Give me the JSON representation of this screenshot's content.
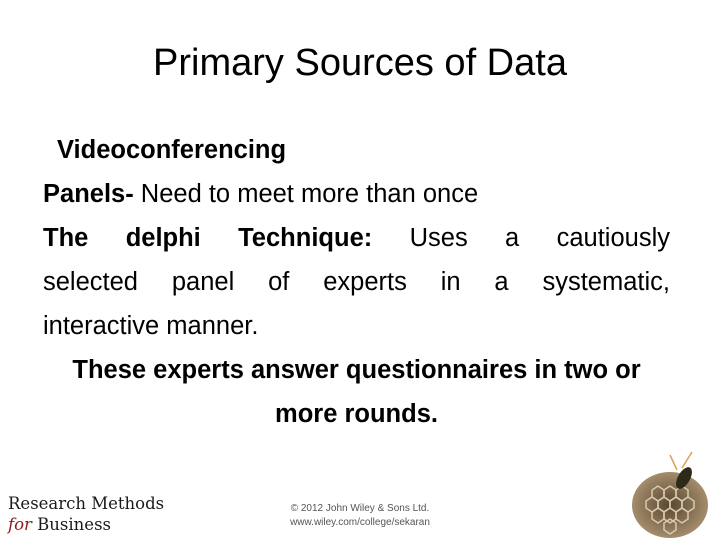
{
  "slide": {
    "title": "Primary Sources of Data",
    "items": {
      "videoconferencing": "Videoconferencing",
      "panels_label": "Panels-",
      "panels_text": " Need to meet more than once",
      "delphi_label": "The delphi Technique:",
      "delphi_text_1": " Uses a cautiously",
      "delphi_text_2": "selected panel of experts in a systematic,",
      "delphi_text_3": "interactive manner.",
      "experts_1": "These experts answer questionnaires in two or",
      "experts_2": "more rounds."
    }
  },
  "footer": {
    "brand_line1": "Research Methods",
    "brand_for": "for",
    "brand_business": " Business",
    "copyright": "© 2012 John Wiley & Sons Ltd.",
    "url": "www.wiley.com/college/sekaran",
    "image": "wasp-nest-icon"
  }
}
